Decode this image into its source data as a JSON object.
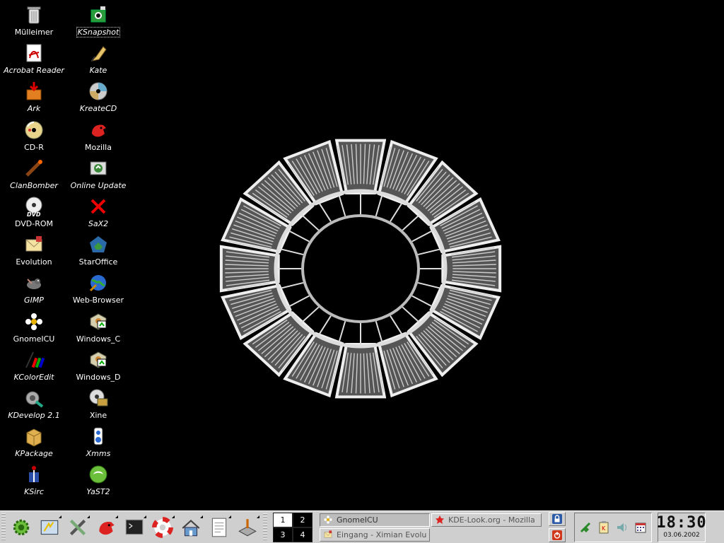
{
  "desktop": {
    "icons_col1": [
      {
        "label": "Mülleimer",
        "icon": "trash-icon",
        "italic": false
      },
      {
        "label": "Acrobat Reader",
        "icon": "acrobat-icon",
        "italic": true
      },
      {
        "label": "Ark",
        "icon": "ark-icon",
        "italic": true
      },
      {
        "label": "CD-R",
        "icon": "cdr-icon",
        "italic": false
      },
      {
        "label": "ClanBomber",
        "icon": "clanbomber-icon",
        "italic": true
      },
      {
        "label": "DVD-ROM",
        "icon": "dvd-icon",
        "italic": false
      },
      {
        "label": "Evolution",
        "icon": "evolution-icon",
        "italic": false
      },
      {
        "label": "GIMP",
        "icon": "gimp-icon",
        "italic": true
      },
      {
        "label": "GnomeICU",
        "icon": "gnomeicu-icon",
        "italic": false
      },
      {
        "label": "KColorEdit",
        "icon": "kcoloredit-icon",
        "italic": true
      },
      {
        "label": "KDevelop 2.1",
        "icon": "kdevelop-icon",
        "italic": true
      },
      {
        "label": "KPackage",
        "icon": "kpackage-icon",
        "italic": true
      },
      {
        "label": "KSirc",
        "icon": "ksirc-icon",
        "italic": true
      }
    ],
    "icons_col2": [
      {
        "label": "KSnapshot",
        "icon": "ksnapshot-icon",
        "italic": true,
        "selected": true
      },
      {
        "label": "Kate",
        "icon": "kate-icon",
        "italic": true
      },
      {
        "label": "KreateCD",
        "icon": "kreatecd-icon",
        "italic": true
      },
      {
        "label": "Mozilla",
        "icon": "mozilla-icon",
        "italic": false
      },
      {
        "label": "Online Update",
        "icon": "online-update-icon",
        "italic": true
      },
      {
        "label": "SaX2",
        "icon": "sax2-icon",
        "italic": true
      },
      {
        "label": "StarOffice",
        "icon": "staroffice-icon",
        "italic": false
      },
      {
        "label": "Web-Browser",
        "icon": "web-browser-icon",
        "italic": false
      },
      {
        "label": "Windows_C",
        "icon": "drive-icon",
        "italic": false
      },
      {
        "label": "Windows_D",
        "icon": "drive-icon",
        "italic": false
      },
      {
        "label": "Xine",
        "icon": "xine-icon",
        "italic": false
      },
      {
        "label": "Xmms",
        "icon": "xmms-icon",
        "italic": true
      },
      {
        "label": "YaST2",
        "icon": "yast-icon",
        "italic": true
      }
    ]
  },
  "panel": {
    "launchers": [
      {
        "icon": "kde-menu-gear-icon"
      },
      {
        "icon": "window-list-icon"
      },
      {
        "icon": "settings-tools-icon"
      },
      {
        "icon": "mozilla-dragon-icon"
      },
      {
        "icon": "terminal-icon"
      },
      {
        "icon": "help-lifebuoy-icon"
      },
      {
        "icon": "home-folder-icon"
      },
      {
        "icon": "text-editor-icon"
      },
      {
        "icon": "office-icon"
      }
    ],
    "pager": {
      "desktops": [
        "1",
        "2",
        "3",
        "4"
      ],
      "active": 0
    },
    "tasks": [
      {
        "label": "GnomeICU",
        "icon": "gnomeicu-icon",
        "active": true
      },
      {
        "label": "KDE-Look.org - Mozilla",
        "icon": "star-icon",
        "active": false
      },
      {
        "label": "Eingang - Ximian Evolution",
        "icon": "evolution-icon",
        "active": false
      }
    ],
    "tray": [
      {
        "icon": "network-plug-icon"
      },
      {
        "icon": "clipboard-klipper-icon"
      },
      {
        "icon": "speaker-icon"
      },
      {
        "icon": "calendar-icon"
      }
    ],
    "clock": {
      "time": "18:30",
      "date": "03.06.2002"
    },
    "colors": {
      "panel_bg": "#cfcfcf",
      "desktop_bg": "#000000"
    }
  }
}
